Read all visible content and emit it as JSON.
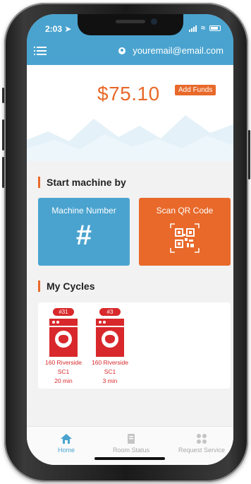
{
  "status": {
    "time": "2:03"
  },
  "header": {
    "email": "youremail@email.com"
  },
  "balance": {
    "amount": "$75.10",
    "add_funds_label": "Add Funds"
  },
  "start": {
    "title": "Start machine by",
    "machine_number": {
      "label": "Machine Number",
      "symbol": "#"
    },
    "scan_qr": {
      "label": "Scan QR Code"
    }
  },
  "cycles": {
    "title": "My Cycles",
    "items": [
      {
        "badge": "#31",
        "location": "160 Riverside",
        "room": "SC1",
        "time": "20 min"
      },
      {
        "badge": "#3",
        "location": "160 Riverside",
        "room": "SC1",
        "time": "3 min"
      }
    ]
  },
  "tabs": [
    {
      "label": "Home",
      "icon": "home-icon",
      "active": true
    },
    {
      "label": "Room Status",
      "icon": "room-status-icon",
      "active": false
    },
    {
      "label": "Request Service",
      "icon": "request-service-icon",
      "active": false
    }
  ],
  "colors": {
    "primary": "#4aa3cf",
    "accent": "#e8692a",
    "cycle": "#d8282b"
  }
}
